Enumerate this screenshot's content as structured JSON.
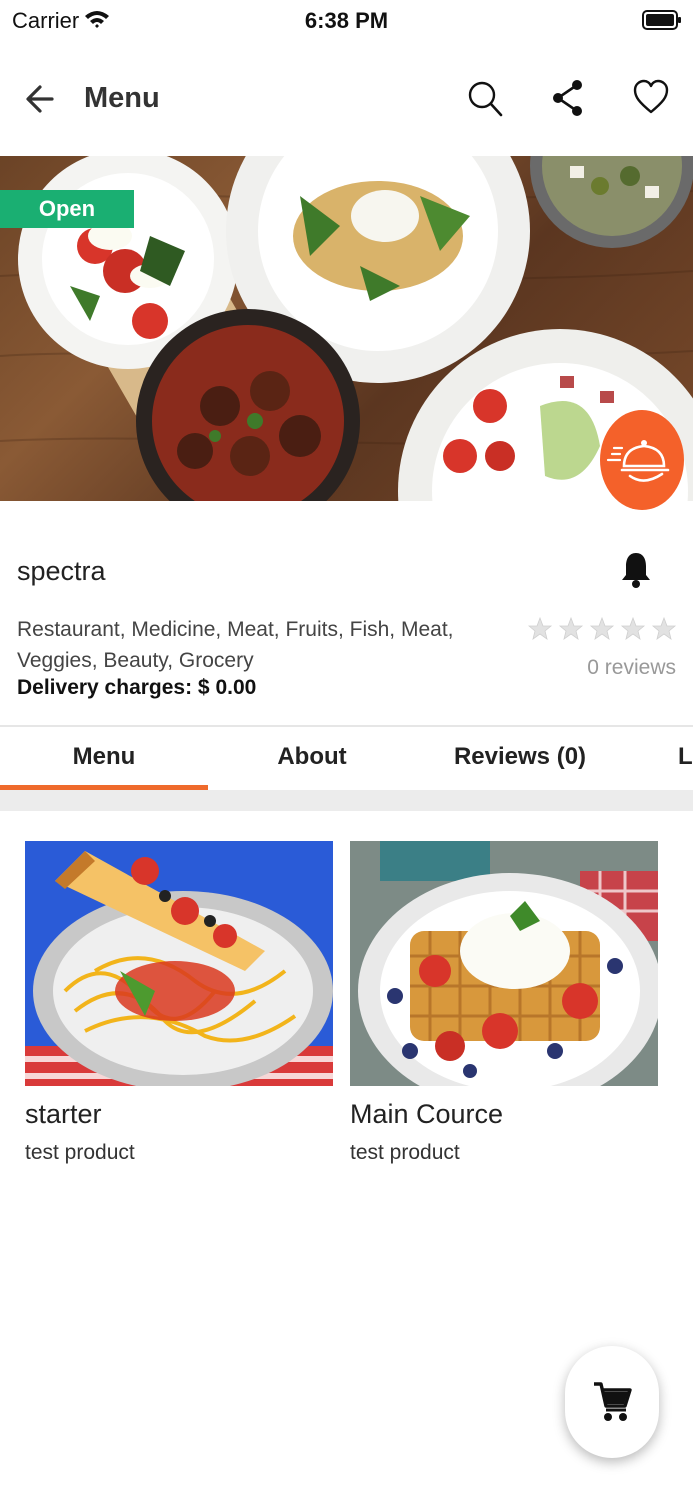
{
  "status_bar": {
    "carrier": "Carrier",
    "time": "6:38 PM"
  },
  "header": {
    "title": "Menu"
  },
  "hero": {
    "badge": "Open"
  },
  "store": {
    "name": "spectra",
    "categories": "Restaurant, Medicine, Meat, Fruits, Fish, Meat, Veggies, Beauty, Grocery",
    "delivery_charges": "Delivery charges: $ 0.00",
    "rating": 0,
    "reviews": "0 reviews"
  },
  "tabs": [
    {
      "label": "Menu",
      "active": true
    },
    {
      "label": "About",
      "active": false
    },
    {
      "label": "Reviews (0)",
      "active": false
    },
    {
      "label": "L",
      "active": false
    }
  ],
  "products": [
    {
      "name": "starter",
      "description": "test product"
    },
    {
      "name": "Main Cource",
      "description": "test product"
    }
  ],
  "colors": {
    "accent": "#ef6a2c",
    "open_badge": "#1aaf72",
    "fab": "#f4612a"
  }
}
